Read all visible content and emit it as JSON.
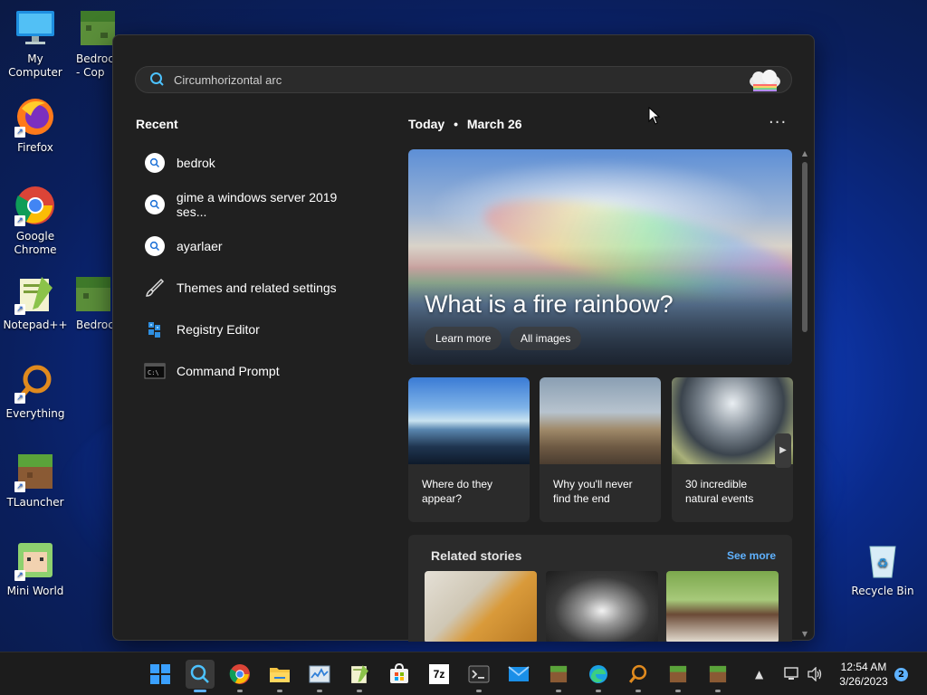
{
  "desktop": {
    "icons": [
      {
        "label": "My Computer",
        "icon": "monitor-icon"
      },
      {
        "label": "Bedrock\n- Cop",
        "icon": "minecraft-block-icon"
      },
      {
        "label": "Firefox",
        "icon": "firefox-icon"
      },
      {
        "label": "Google Chrome",
        "icon": "chrome-icon"
      },
      {
        "label": "Notepad++",
        "icon": "notepadpp-icon"
      },
      {
        "label": "Bedrock",
        "icon": "minecraft-block-icon"
      },
      {
        "label": "Everything",
        "icon": "everything-search-icon"
      },
      {
        "label": "TLauncher",
        "icon": "minecraft-block-icon"
      },
      {
        "label": "Mini World",
        "icon": "mini-world-icon"
      },
      {
        "label": "Recycle Bin",
        "icon": "recycle-bin-icon"
      }
    ]
  },
  "search": {
    "value": "Circumhorizontal arc"
  },
  "recent": {
    "title": "Recent",
    "items": [
      {
        "label": "bedrok",
        "icon": "search-icon"
      },
      {
        "label": "gime a windows server 2019 ses...",
        "icon": "search-icon"
      },
      {
        "label": "ayarlaer",
        "icon": "search-icon"
      },
      {
        "label": "Themes and related settings",
        "icon": "brush-icon"
      },
      {
        "label": "Registry Editor",
        "icon": "registry-icon"
      },
      {
        "label": "Command Prompt",
        "icon": "terminal-icon"
      }
    ]
  },
  "today": {
    "label": "Today",
    "separator": "•",
    "date": "March 26",
    "more": "···",
    "hero": {
      "title": "What is a fire rainbow?",
      "learn_more": "Learn more",
      "all_images": "All images"
    },
    "cards": [
      {
        "caption_line1": "Where do they",
        "caption_line2": "appear?"
      },
      {
        "caption_line1": "Why you'll never",
        "caption_line2": "find the end"
      },
      {
        "caption_line1": "30 incredible",
        "caption_line2": "natural events"
      }
    ],
    "related": {
      "title": "Related stories",
      "see_more": "See more"
    }
  },
  "taskbar": {
    "apps": [
      "start-icon",
      "search-icon",
      "chrome-icon",
      "file-explorer-icon",
      "task-manager-icon",
      "notepadpp-icon",
      "store-icon",
      "7zip-icon",
      "terminal-icon",
      "mail-icon",
      "minecraft-block-icon",
      "edge-icon",
      "everything-search-icon",
      "minecraft-block-icon",
      "minecraft-block-icon"
    ],
    "sevenzip_label": "7z",
    "time": "12:54 AM",
    "date": "3/26/2023",
    "notifications": "2"
  },
  "colors": {
    "accent": "#5fb2ff",
    "panel": "#202020",
    "card": "#2b2b2b"
  }
}
